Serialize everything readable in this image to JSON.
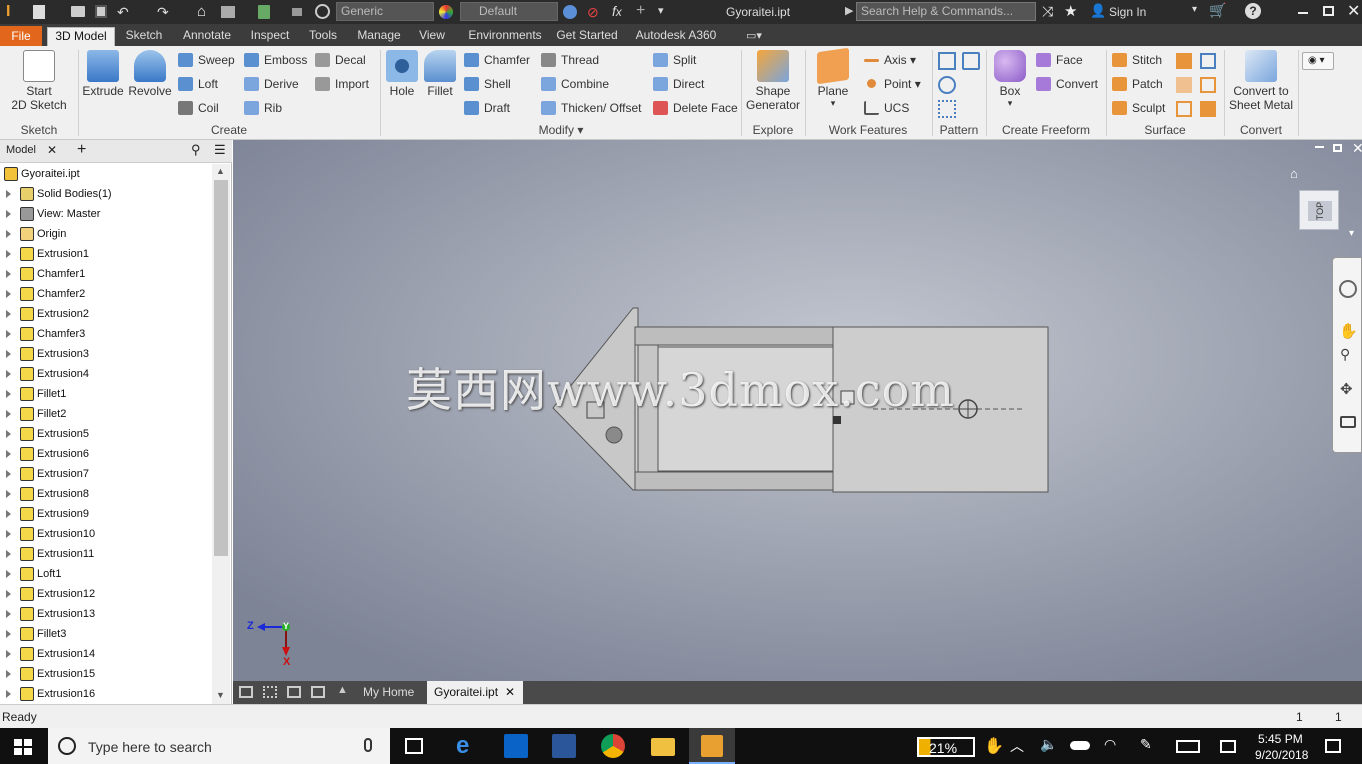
{
  "app": {
    "logo_letter": "I",
    "material_combo": "Generic",
    "appearance_combo": "Default",
    "file_title": "Gyoraitei.ipt",
    "search_placeholder": "Search Help & Commands...",
    "sign_in": "Sign In",
    "help": "?"
  },
  "tabs": [
    "File",
    "3D Model",
    "Sketch",
    "Annotate",
    "Inspect",
    "Tools",
    "Manage",
    "View",
    "Environments",
    "Get Started",
    "Autodesk A360"
  ],
  "ribbon": {
    "sketch": {
      "start_line1": "Start",
      "start_line2": "2D Sketch",
      "panel": "Sketch"
    },
    "create": {
      "extrude": "Extrude",
      "revolve": "Revolve",
      "sweep": "Sweep",
      "loft": "Loft",
      "coil": "Coil",
      "emboss": "Emboss",
      "derive": "Derive",
      "rib": "Rib",
      "decal": "Decal",
      "import": "Import",
      "panel": "Create"
    },
    "modify": {
      "hole": "Hole",
      "fillet": "Fillet",
      "chamfer": "Chamfer",
      "shell": "Shell",
      "draft": "Draft",
      "thread": "Thread",
      "combine": "Combine",
      "thicken": "Thicken/ Offset",
      "split": "Split",
      "direct": "Direct",
      "delete_face": "Delete Face",
      "panel": "Modify"
    },
    "explore": {
      "shape_line1": "Shape",
      "shape_line2": "Generator",
      "panel": "Explore"
    },
    "work": {
      "plane": "Plane",
      "axis": "Axis",
      "point": "Point",
      "ucs": "UCS",
      "panel": "Work Features"
    },
    "pattern": {
      "panel": "Pattern"
    },
    "freeform": {
      "box": "Box",
      "face": "Face",
      "convert": "Convert",
      "panel": "Create Freeform"
    },
    "surface": {
      "stitch": "Stitch",
      "patch": "Patch",
      "sculpt": "Sculpt",
      "panel": "Surface"
    },
    "convert": {
      "line1": "Convert to",
      "line2": "Sheet Metal",
      "panel": "Convert"
    }
  },
  "browser": {
    "tab": "Model",
    "items": [
      {
        "label": "Gyoraitei.ipt",
        "icon": "part-icon"
      },
      {
        "label": "Solid Bodies(1)",
        "icon": "solid-bodies-icon"
      },
      {
        "label": "View: Master",
        "icon": "view-icon"
      },
      {
        "label": "Origin",
        "icon": "folder-icon"
      },
      {
        "label": "Extrusion1",
        "icon": "extrusion-icon"
      },
      {
        "label": "Chamfer1",
        "icon": "chamfer-icon"
      },
      {
        "label": "Chamfer2",
        "icon": "chamfer-icon"
      },
      {
        "label": "Extrusion2",
        "icon": "extrusion-icon"
      },
      {
        "label": "Chamfer3",
        "icon": "chamfer-icon"
      },
      {
        "label": "Extrusion3",
        "icon": "extrusion-icon"
      },
      {
        "label": "Extrusion4",
        "icon": "extrusion-icon"
      },
      {
        "label": "Fillet1",
        "icon": "fillet-icon"
      },
      {
        "label": "Fillet2",
        "icon": "fillet-icon"
      },
      {
        "label": "Extrusion5",
        "icon": "extrusion-icon"
      },
      {
        "label": "Extrusion6",
        "icon": "extrusion-icon"
      },
      {
        "label": "Extrusion7",
        "icon": "extrusion-icon"
      },
      {
        "label": "Extrusion8",
        "icon": "extrusion-icon"
      },
      {
        "label": "Extrusion9",
        "icon": "extrusion-icon"
      },
      {
        "label": "Extrusion10",
        "icon": "extrusion-icon"
      },
      {
        "label": "Extrusion11",
        "icon": "extrusion-icon"
      },
      {
        "label": "Loft1",
        "icon": "loft-icon"
      },
      {
        "label": "Extrusion12",
        "icon": "extrusion-icon"
      },
      {
        "label": "Extrusion13",
        "icon": "extrusion-icon"
      },
      {
        "label": "Fillet3",
        "icon": "fillet-icon"
      },
      {
        "label": "Extrusion14",
        "icon": "extrusion-icon"
      },
      {
        "label": "Extrusion15",
        "icon": "extrusion-icon"
      },
      {
        "label": "Extrusion16",
        "icon": "extrusion-icon"
      }
    ]
  },
  "viewport": {
    "viewcube_label": "TOP",
    "watermark": "莫西网www.3dmox.com",
    "axis_z": "Z",
    "axis_y": "Y",
    "axis_x": "X"
  },
  "doc_tabs": {
    "home": "My Home",
    "active": "Gyoraitei.ipt"
  },
  "status": {
    "text": "Ready",
    "count1": "1",
    "count2": "1"
  },
  "taskbar": {
    "search_placeholder": "Type here to search",
    "battery": "21%",
    "time": "5:45 PM",
    "date": "9/20/2018"
  },
  "colors": {
    "file_tab": "#e2661b",
    "title_bg": "#2b2b2b",
    "viewport_center": "#c3c7d0",
    "viewport_edge": "#7d8496"
  }
}
